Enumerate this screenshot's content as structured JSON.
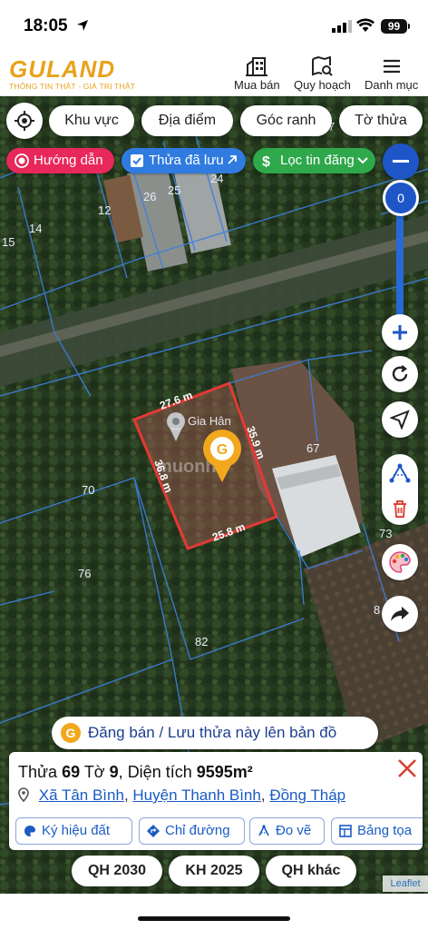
{
  "status_bar": {
    "time": "18:05",
    "battery": "99"
  },
  "header": {
    "logo": "GULAND",
    "tagline": "THÔNG TIN THẬT - GIÁ TRỊ THẬT",
    "nav": [
      {
        "label": "Mua bán",
        "icon": "building-icon"
      },
      {
        "label": "Quy hoạch",
        "icon": "map-search-icon"
      },
      {
        "label": "Danh mục",
        "icon": "menu-icon"
      }
    ]
  },
  "map": {
    "filter_chips": [
      "Khu vực",
      "Địa điểm",
      "Góc ranh",
      "Tờ thửa"
    ],
    "pills": {
      "guide": "Hướng dẫn",
      "saved": "Thửa đã lưu",
      "filter": "Lọc tin đăng"
    },
    "zoom_value": "0",
    "plot_numbers": [
      "26",
      "25",
      "24",
      "12",
      "14",
      "15",
      "67",
      "70",
      "76",
      "82",
      "73",
      "8",
      "7"
    ],
    "selected_parcel_edges": [
      "27.6 m",
      "35.9 m",
      "36.8 m",
      "25.8 m"
    ],
    "marker_label": "Gia Hân",
    "watermark": "muonhà",
    "post_banner": "Đăng bán / Lưu thửa này lên bản đồ",
    "attribution": "Leaflet"
  },
  "parcel_card": {
    "label_parcel": "Thửa",
    "parcel_number": "69",
    "label_sheet": "Tờ",
    "sheet_number": "9",
    "label_area": "Diện tích",
    "area": "9595m²",
    "commune": "Xã Tân Bình",
    "district": "Huyện Thanh Bình",
    "province": "Đồng Tháp",
    "actions": [
      "Ký hiệu đất",
      "Chỉ đường",
      "Đo vẽ",
      "Bảng tọa"
    ]
  },
  "planning_buttons": [
    "QH 2030",
    "KH 2025",
    "QH khác"
  ],
  "colors": {
    "brand": "#e9a21b",
    "link": "#1a5bc4",
    "guide_pill": "#e8285a",
    "saved_pill": "#2f7be0",
    "filter_pill": "#2ea84a",
    "parcel_outline": "#e53935"
  }
}
